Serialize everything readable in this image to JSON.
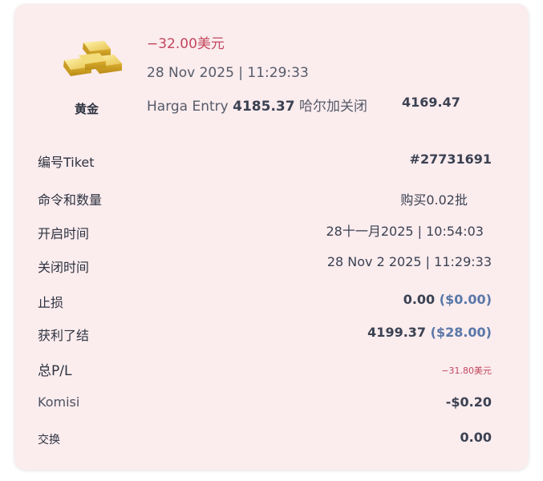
{
  "asset": {
    "name": "黄金",
    "icon": "gold-bars-icon"
  },
  "header": {
    "pnl": "−32.00美元",
    "close_datetime": "28 Nov 2025 | 11:29:33",
    "entry_label": "Harga Entry",
    "entry_price": "4185.37",
    "close_label": "哈尔加关闭",
    "close_price": "4169.47"
  },
  "details": {
    "ticket": {
      "label": "编号Tiket",
      "value": "#27731691"
    },
    "order": {
      "label": "命令和数量",
      "value": "购买0.02批"
    },
    "open_time": {
      "label": "开启时间",
      "value": "28十一月2025 | 10:54:03"
    },
    "close_time": {
      "label": "关闭时间",
      "value": "28 Nov 2 2025 | 11:29:33"
    },
    "stop_loss": {
      "label": "止损",
      "value": "0.00",
      "sub": "($0.00)"
    },
    "take_profit": {
      "label": "获利了结",
      "value": "4199.37",
      "sub": "($28.00)"
    },
    "total_pl": {
      "label": "总P/L",
      "value": "−31.80美元"
    },
    "commission": {
      "label": "Komisi",
      "value": "-$0.20"
    },
    "swap": {
      "label": "交换",
      "value": "0.00"
    }
  },
  "colors": {
    "card_bg": "#fbecee",
    "loss": "#c2475d",
    "accent_blue": "#5a77a8",
    "gold": "#e8c64a"
  }
}
